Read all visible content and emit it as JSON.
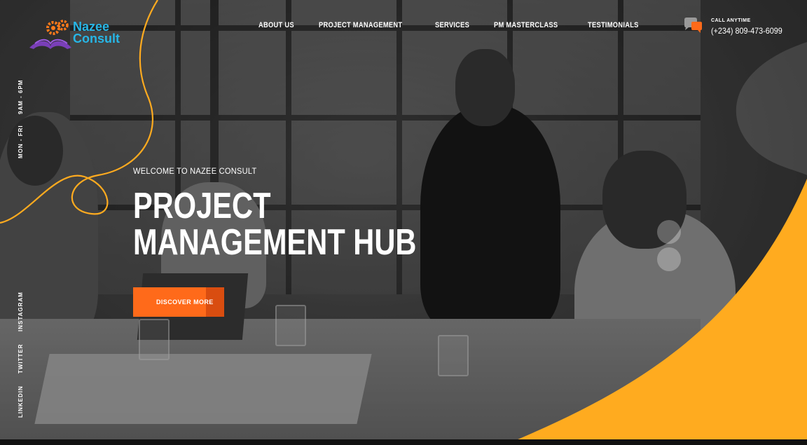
{
  "brand": {
    "name_line1": "Nazee",
    "name_line2": "Consult",
    "accent": "#27b6e6",
    "secondary": "#ff7a1a"
  },
  "nav": {
    "items": [
      {
        "label": "ABOUT US"
      },
      {
        "label": "PROJECT MANAGEMENT"
      },
      {
        "label": "SERVICES"
      },
      {
        "label": "PM MASTERCLASS"
      },
      {
        "label": "TESTIMONIALS"
      }
    ]
  },
  "call": {
    "label": "CALL ANYTIME",
    "number": "(+234) 809-473-6099",
    "icon": "chat-bubble-icon"
  },
  "side": {
    "hours": "9AM - 6PM",
    "days": "MON - FRI",
    "social": [
      "INSTAGRAM",
      "TWITTER",
      "LINKEDIN"
    ]
  },
  "hero": {
    "welcome": "WELCOME TO NAZEE CONSULT",
    "title_line1": "PROJECT",
    "title_line2": "MANAGEMENT HUB",
    "cta": "DISCOVER MORE"
  },
  "colors": {
    "orange": "#ffab1f",
    "cta": "#ff6a1a"
  }
}
